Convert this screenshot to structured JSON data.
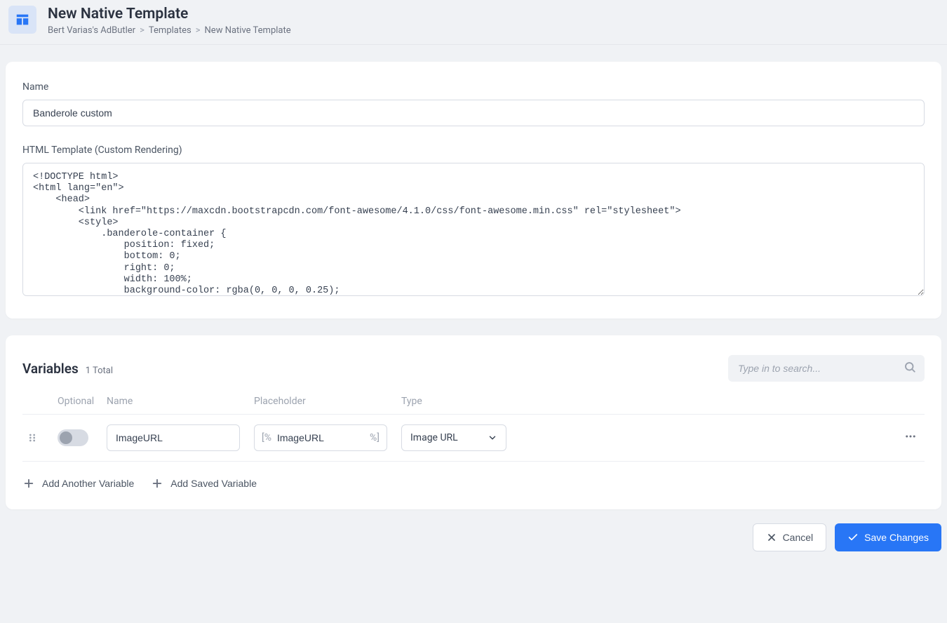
{
  "header": {
    "title": "New Native Template",
    "breadcrumb": {
      "a": "Bert Varias's AdButler",
      "b": "Templates",
      "c": "New Native Template"
    }
  },
  "form": {
    "name_label": "Name",
    "name_value": "Banderole custom",
    "code_label": "HTML Template (Custom Rendering)",
    "code_value": "<!DOCTYPE html>\n<html lang=\"en\">\n    <head>\n        <link href=\"https://maxcdn.bootstrapcdn.com/font-awesome/4.1.0/css/font-awesome.min.css\" rel=\"stylesheet\">\n        <style>\n            .banderole-container {\n                position: fixed;\n                bottom: 0;\n                right: 0;\n                width: 100%;\n                background-color: rgba(0, 0, 0, 0.25);"
  },
  "variables": {
    "title": "Variables",
    "count_text": "1 Total",
    "search_placeholder": "Type in to search...",
    "cols": {
      "optional": "Optional",
      "name": "Name",
      "placeholder": "Placeholder",
      "type": "Type"
    },
    "rows": [
      {
        "name": "ImageURL",
        "placeholder_prefix": "[%",
        "placeholder_value": "ImageURL",
        "placeholder_suffix": "%]",
        "type": "Image URL"
      }
    ],
    "add_another": "Add Another Variable",
    "add_saved": "Add Saved Variable"
  },
  "footer": {
    "cancel": "Cancel",
    "save": "Save Changes"
  }
}
